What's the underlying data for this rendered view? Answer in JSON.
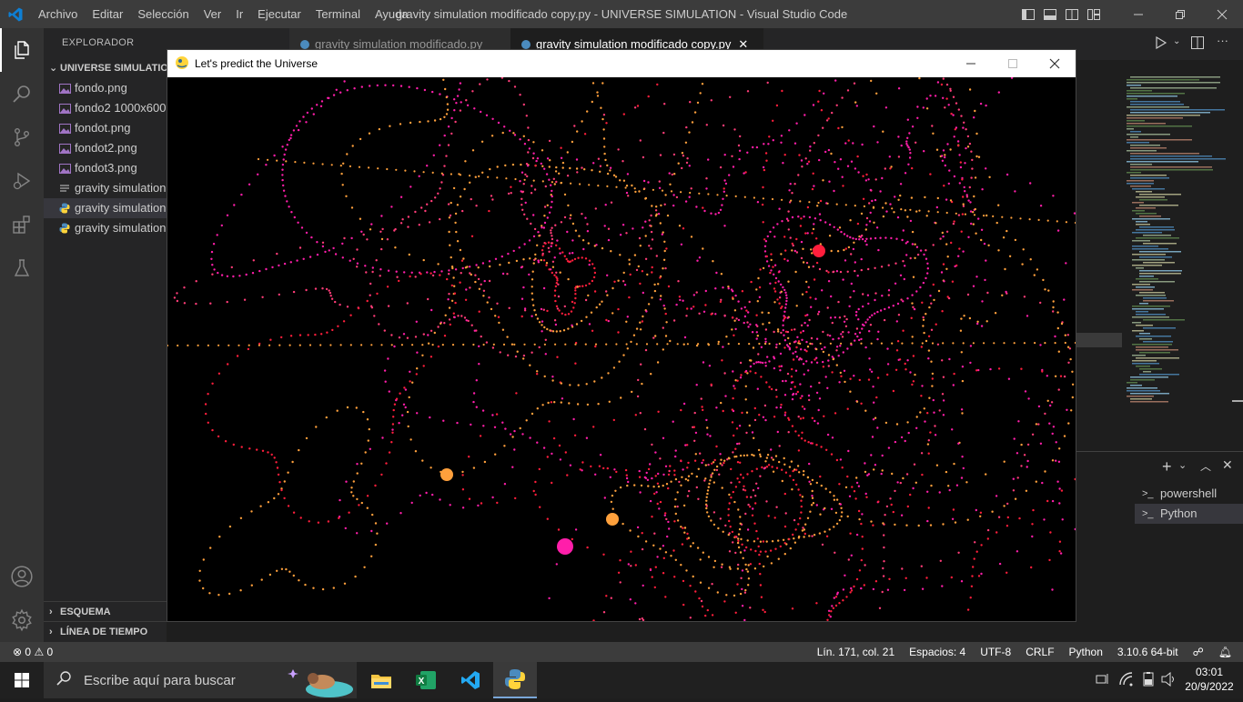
{
  "titlebar": {
    "menu": [
      "Archivo",
      "Editar",
      "Selección",
      "Ver",
      "Ir",
      "Ejecutar",
      "Terminal",
      "Ayuda"
    ],
    "title": "gravity simulation modificado copy.py - UNIVERSE SIMULATION - Visual Studio Code"
  },
  "sidebar": {
    "header": "EXPLORADOR",
    "more": "···",
    "folder": "UNIVERSE SIMULATION",
    "files": [
      {
        "name": "fondo.png",
        "icon": "image-icon"
      },
      {
        "name": "fondo2 1000x600",
        "icon": "image-icon"
      },
      {
        "name": "fondot.png",
        "icon": "image-icon"
      },
      {
        "name": "fondot2.png",
        "icon": "image-icon"
      },
      {
        "name": "fondot3.png",
        "icon": "image-icon"
      },
      {
        "name": "gravity simulation",
        "icon": "text-file-icon"
      },
      {
        "name": "gravity simulation",
        "icon": "python-icon"
      },
      {
        "name": "gravity simulation",
        "icon": "python-icon"
      }
    ],
    "outline": "ESQUEMA",
    "timeline": "LÍNEA DE TIEMPO"
  },
  "tabs": [
    {
      "label": "gravity simulation modificado.py",
      "active": false
    },
    {
      "label": "gravity simulation modificado copy.py",
      "active": true
    }
  ],
  "panel": {
    "terminals": [
      "powershell",
      "Python"
    ],
    "selected": "Python"
  },
  "statusbar": {
    "errors": "0",
    "warnings": "0",
    "position": "Lín. 171, col. 21",
    "spaces": "Espacios: 4",
    "encoding": "UTF-8",
    "eol": "CRLF",
    "language": "Python",
    "interpreter": "3.10.6 64-bit"
  },
  "taskbar": {
    "search_placeholder": "Escribe aquí para buscar",
    "time": "03:01",
    "date": "20/9/2022"
  },
  "pygame": {
    "title": "Let's predict the Universe",
    "colors": {
      "red": "#ff1e3c",
      "magenta": "#ff1eaa",
      "orange": "#ffa03c",
      "pink": "#ff3c78"
    }
  },
  "colors": {
    "accent": "#007acc",
    "titlebar": "#3c3c3c",
    "activitybar": "#333333",
    "sidebar": "#252526",
    "editor": "#1e1e1e"
  }
}
